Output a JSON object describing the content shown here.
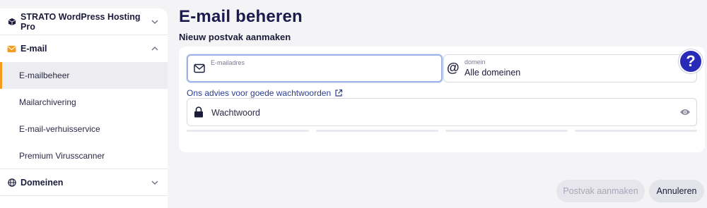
{
  "sidebar": {
    "product": {
      "label": "STRATO WordPress Hosting Pro",
      "icon": "cube-icon"
    },
    "email_section": {
      "label": "E-mail",
      "icon": "envelope-icon",
      "accent": "#f39c1f",
      "items": [
        {
          "label": "E-mailbeheer",
          "active": true
        },
        {
          "label": "Mailarchivering",
          "active": false
        },
        {
          "label": "E-mail-verhuisservice",
          "active": false
        },
        {
          "label": "Premium Virusscanner",
          "active": false
        }
      ]
    },
    "domains_section": {
      "label": "Domeinen",
      "icon": "globe-icon"
    }
  },
  "main": {
    "title": "E-mail beheren",
    "subtitle": "Nieuw postvak aanmaken",
    "email_field": {
      "label": "E-mailadres",
      "value": "",
      "icon": "envelope-icon"
    },
    "domain_field": {
      "label": "domein",
      "value": "Alle domeinen",
      "icon": "at-icon"
    },
    "advice_link": "Ons advies voor goede wachtwoorden",
    "password_field": {
      "placeholder": "Wachtwoord",
      "icon": "lock-icon"
    },
    "help_icon": "?"
  },
  "footer": {
    "create_label": "Postvak aanmaken",
    "cancel_label": "Annuleren"
  },
  "colors": {
    "brand": "#1b1b4f",
    "help": "#2a2ab8",
    "link": "#2c3e8f"
  }
}
